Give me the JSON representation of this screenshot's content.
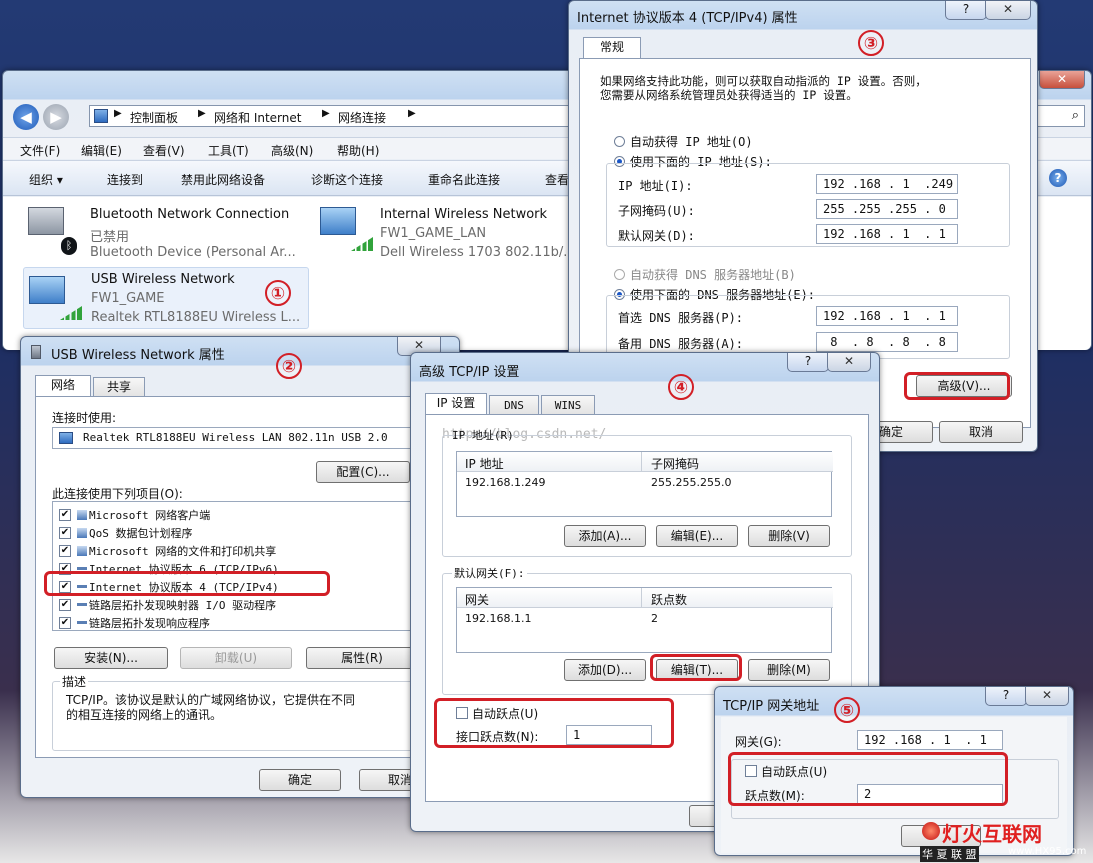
{
  "explorer": {
    "breadcrumb": [
      "控制面板",
      "网络和 Internet",
      "网络连接"
    ],
    "menu": [
      "文件(F)",
      "编辑(E)",
      "查看(V)",
      "工具(T)",
      "高级(N)",
      "帮助(H)"
    ],
    "toolbar": [
      "组织 ▾",
      "连接到",
      "禁用此网络设备",
      "诊断这个连接",
      "重命名此连接",
      "查看"
    ],
    "connections": [
      {
        "name": "Bluetooth Network Connection",
        "status": "已禁用",
        "device": "Bluetooth Device (Personal Ar..."
      },
      {
        "name": "Internal Wireless Network",
        "status": "FW1_GAME_LAN",
        "device": "Dell Wireless 1703 802.11b/..."
      },
      {
        "name": "USB Wireless Network",
        "status": "FW1_GAME",
        "device": "Realtek RTL8188EU Wireless L..."
      }
    ]
  },
  "markers": [
    "①",
    "②",
    "③",
    "④",
    "⑤"
  ],
  "props": {
    "title": "USB Wireless Network 属性",
    "tabs": [
      "网络",
      "共享"
    ],
    "connect_using_label": "连接时使用:",
    "adapter": "Realtek RTL8188EU Wireless LAN 802.11n USB 2.0",
    "configure": "配置(C)...",
    "items_label": "此连接使用下列项目(O):",
    "items": [
      "Microsoft 网络客户端",
      "QoS 数据包计划程序",
      "Microsoft 网络的文件和打印机共享",
      "Internet 协议版本 6 (TCP/IPv6)",
      "Internet 协议版本 4 (TCP/IPv4)",
      "链路层拓扑发现映射器 I/O 驱动程序",
      "链路层拓扑发现响应程序"
    ],
    "install": "安装(N)...",
    "uninstall": "卸载(U)",
    "properties": "属性(R)",
    "desc_label": "描述",
    "desc_text": [
      "TCP/IP。该协议是默认的广域网络协议，它提供在不同",
      "的相互连接的网络上的通讯。"
    ],
    "ok": "确定",
    "cancel": "取消"
  },
  "ipv4": {
    "title": "Internet 协议版本 4 (TCP/IPv4) 属性",
    "tab": "常规",
    "intro": [
      "如果网络支持此功能，则可以获取自动指派的 IP 设置。否则，",
      "您需要从网络系统管理员处获得适当的 IP 设置。"
    ],
    "auto_ip": "自动获得 IP 地址(O)",
    "use_ip": "使用下面的 IP 地址(S):",
    "ip_label": "IP 地址(I):",
    "ip": "192 .168 . 1  .249",
    "mask_label": "子网掩码(U):",
    "mask": "255 .255 .255 . 0",
    "gw_label": "默认网关(D):",
    "gw": "192 .168 . 1  . 1",
    "auto_dns": "自动获得 DNS 服务器地址(B)",
    "use_dns": "使用下面的 DNS 服务器地址(E):",
    "dns1_label": "首选 DNS 服务器(P):",
    "dns1": "192 .168 . 1  . 1",
    "dns2_label": "备用 DNS 服务器(A):",
    "dns2": " 8  . 8  . 8  . 8",
    "advanced": "高级(V)...",
    "ok": "确定",
    "cancel": "取消"
  },
  "adv": {
    "title": "高级 TCP/IP 设置",
    "tabs": [
      "IP 设置",
      "DNS",
      "WINS"
    ],
    "watermark": "http://blog.csdn.net/",
    "ip_group": "IP 地址(R)",
    "ip_cols": [
      "IP 地址",
      "子网掩码"
    ],
    "ip_row": [
      "192.168.1.249",
      "255.255.255.0"
    ],
    "gw_group": "默认网关(F):",
    "gw_cols": [
      "网关",
      "跃点数"
    ],
    "gw_row": [
      "192.168.1.1",
      "2"
    ],
    "add_ip": "添加(A)...",
    "edit_ip": "编辑(E)...",
    "del_ip": "删除(V)",
    "add_gw": "添加(D)...",
    "edit_gw": "编辑(T)...",
    "del_gw": "删除(M)",
    "auto_metric": "自动跃点(U)",
    "iface_metric_label": "接口跃点数(N):",
    "iface_metric": "1"
  },
  "gwdlg": {
    "title": "TCP/IP 网关地址",
    "gw_label": "网关(G):",
    "gw": "192 .168 . 1  . 1",
    "auto_metric": "自动跃点(U)",
    "metric_label": "跃点数(M):",
    "metric": "2"
  },
  "watermark_logo": {
    "main": "灯火互联网",
    "sub": "华 夏 联 盟",
    "url": "www.HX95.com"
  },
  "colors": {
    "highlight": "#d21f26"
  }
}
